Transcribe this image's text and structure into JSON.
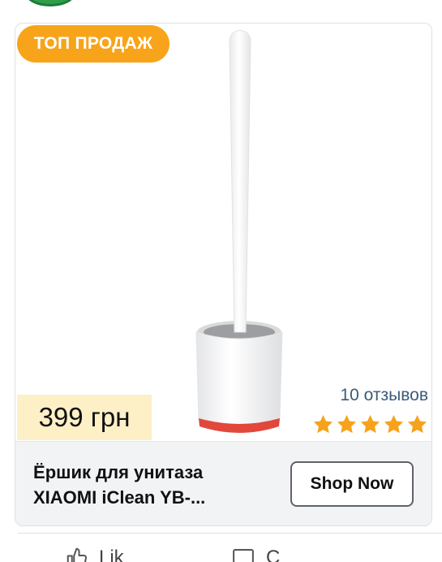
{
  "product": {
    "badge": "ТОП ПРОДАЖ",
    "price": "399 грн",
    "reviews": "10 отзывов",
    "rating_stars": 5,
    "title_line1": "Ёршик для унитаза",
    "title_line2": "XIAOMI iClean YB-..."
  },
  "cta": {
    "label": "Shop Now"
  },
  "actions": {
    "like_label": "Lik",
    "comment_label": "C"
  },
  "colors": {
    "badge": "#f8a41a",
    "price_bg": "#fdf0c7",
    "star": "#f7a21b",
    "reviews_text": "#3b5b7a"
  },
  "icons": [
    "thumbs-up-icon",
    "comment-icon",
    "star-icon"
  ]
}
